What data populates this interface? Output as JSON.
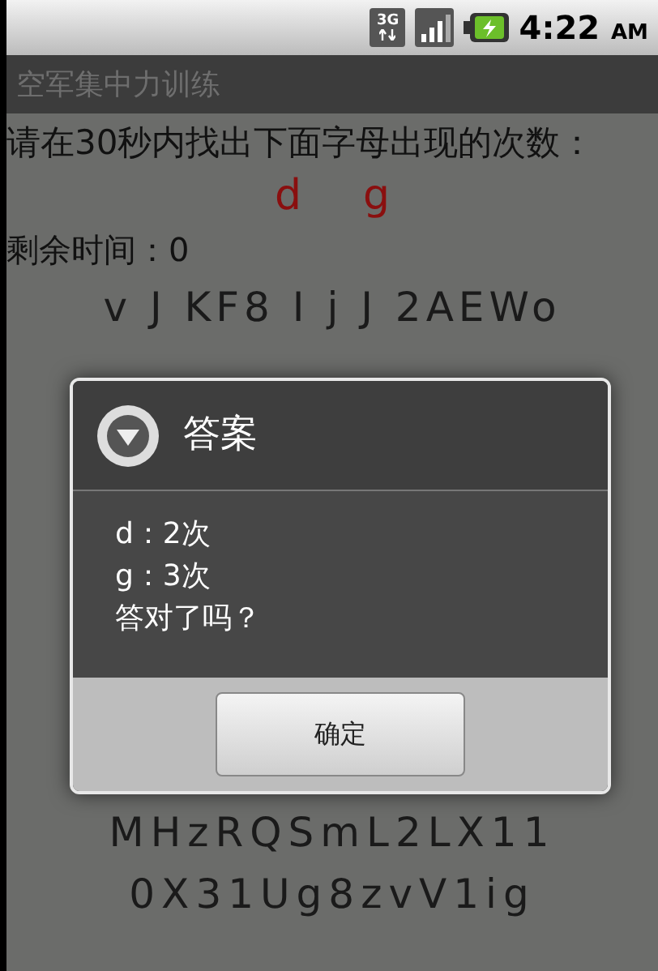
{
  "status_bar": {
    "network_type": "3G",
    "time": "4:22",
    "ampm": "AM"
  },
  "title_bar": {
    "title": "空军集中力训练"
  },
  "instruction": "请在30秒内找出下面字母出现的次数：",
  "targets": [
    "d",
    "g"
  ],
  "remaining": "剩余时间：0",
  "grid_top": [
    "v J KF8 I j J 2AEWo"
  ],
  "grid_bottom": [
    "MHzRQSmL2LX11",
    "0X31Ug8zvV1ig"
  ],
  "dialog": {
    "title": "答案",
    "lines": [
      "d：2次",
      "g：3次",
      "答对了吗？"
    ],
    "button": "确定"
  }
}
